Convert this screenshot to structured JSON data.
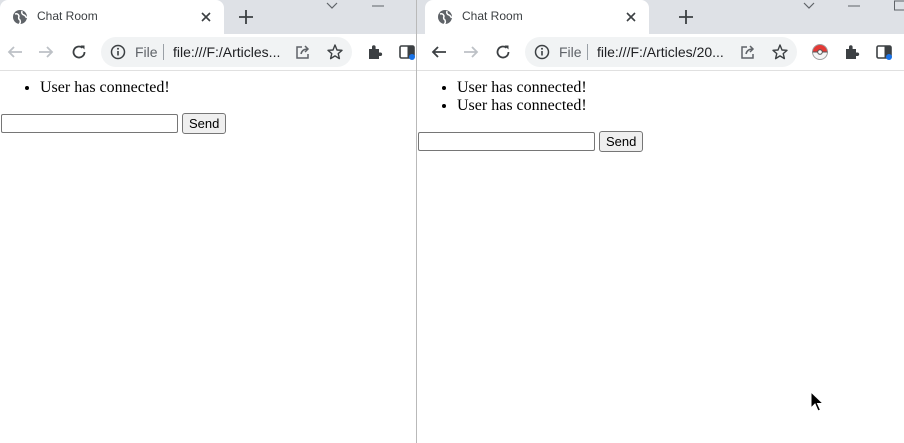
{
  "left_window": {
    "tab": {
      "title": "Chat Room",
      "favicon": "globe-icon",
      "close_icon": "close-icon"
    },
    "new_tab_icon": "plus-icon",
    "toolbar": {
      "back_icon": "back-arrow-icon",
      "forward_icon": "forward-arrow-icon",
      "reload_icon": "reload-icon",
      "site_info_icon": "info-icon",
      "scheme_label": "File",
      "url": "file:///F:/Articles...",
      "share_icon": "share-icon",
      "bookmark_icon": "star-icon",
      "extensions_icon": "puzzle-icon",
      "sidepanel_icon": "side-panel-icon"
    },
    "page": {
      "messages": [
        "User has connected!"
      ],
      "message_input": {
        "value": "",
        "placeholder": ""
      },
      "send_label": "Send"
    }
  },
  "right_window": {
    "tab": {
      "title": "Chat Room",
      "favicon": "globe-icon",
      "close_icon": "close-icon"
    },
    "new_tab_icon": "plus-icon",
    "toolbar": {
      "back_icon": "back-arrow-icon",
      "forward_icon": "forward-arrow-icon",
      "reload_icon": "reload-icon",
      "site_info_icon": "info-icon",
      "scheme_label": "File",
      "url": "file:///F:/Articles/20...",
      "share_icon": "share-icon",
      "bookmark_icon": "star-icon",
      "profile_icon": "pokeball-icon",
      "extensions_icon": "puzzle-icon",
      "sidepanel_icon": "side-panel-icon"
    },
    "page": {
      "messages": [
        "User has connected!",
        "User has connected!"
      ],
      "message_input": {
        "value": "",
        "placeholder": ""
      },
      "send_label": "Send"
    }
  },
  "colors": {
    "tabbar_bg": "#dee1e6",
    "omnibox_bg": "#f1f3f4",
    "icon_gray": "#5f6368",
    "disabled_gray": "#bdc1c6",
    "badge_blue": "#1a73e8",
    "pokeball_red": "#e53935"
  }
}
